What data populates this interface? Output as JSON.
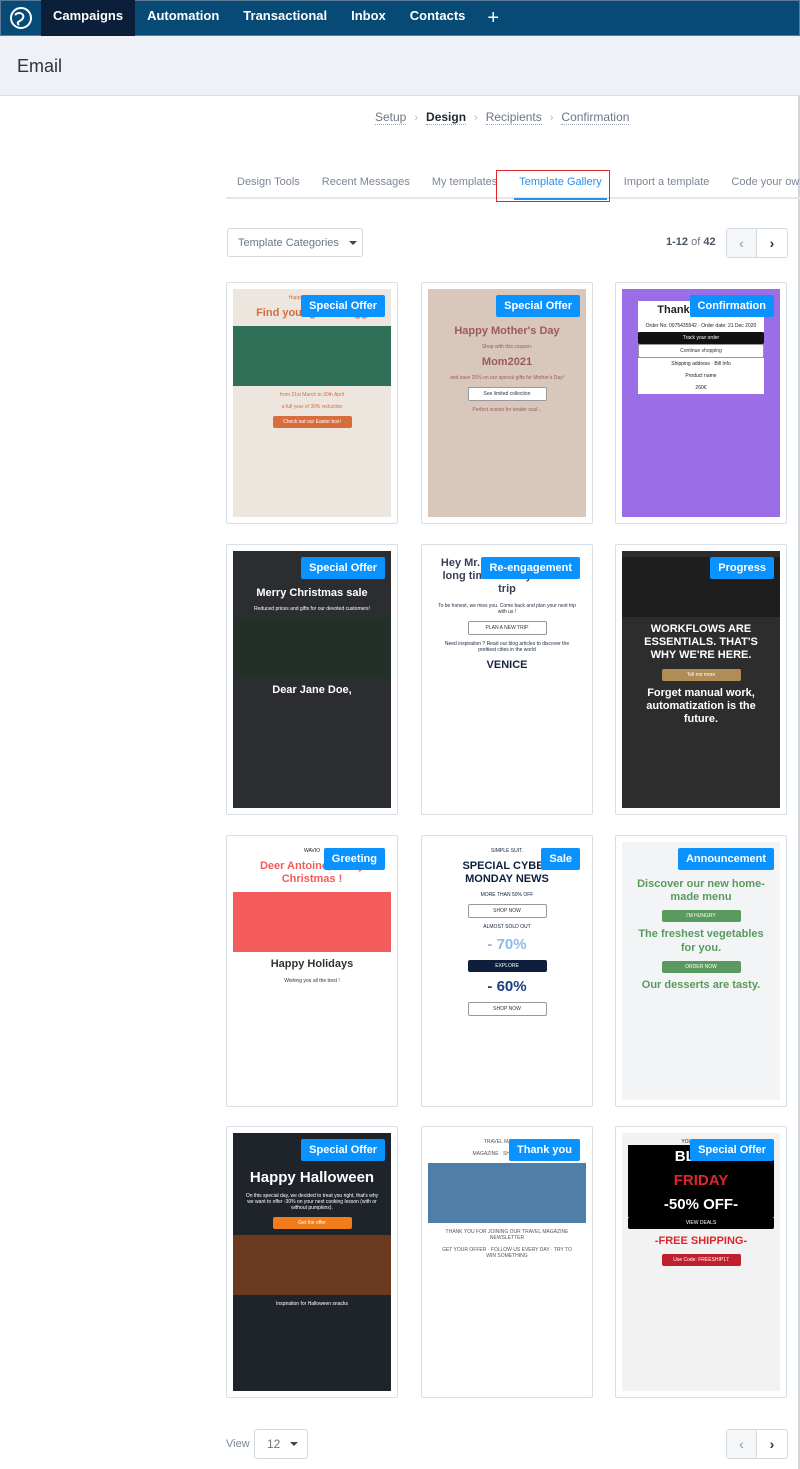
{
  "nav": {
    "items": [
      {
        "label": "Campaigns",
        "active": true
      },
      {
        "label": "Automation"
      },
      {
        "label": "Transactional"
      },
      {
        "label": "Inbox"
      },
      {
        "label": "Contacts"
      }
    ],
    "plus": "+"
  },
  "header": {
    "title": "Email"
  },
  "breadcrumb": [
    {
      "label": "Setup"
    },
    {
      "label": "Design",
      "current": true
    },
    {
      "label": "Recipients"
    },
    {
      "label": "Confirmation"
    }
  ],
  "tabs": [
    {
      "label": "Design Tools"
    },
    {
      "label": "Recent Messages"
    },
    {
      "label": "My templates"
    },
    {
      "label": "Template Gallery",
      "active": true
    },
    {
      "label": "Import a template"
    },
    {
      "label": "Code your own"
    }
  ],
  "toolbar": {
    "categories": "Template Categories",
    "range": "1-12",
    "of": "of",
    "total": "42",
    "prev": "‹",
    "next": "›"
  },
  "footer": {
    "view_label": "View",
    "view_value": "12"
  },
  "colors": {
    "nav": "#064a75",
    "accent": "#2a8ff0",
    "badge": "#0a92ff"
  },
  "templates": [
    {
      "badge": "Special Offer",
      "bg": "#ece6df",
      "fg": "#d76d3c",
      "lines": [
        {
          "t": "Happy Easter to you!",
          "s": "body"
        },
        {
          "t": "Find your golden egg",
          "s": "title"
        },
        {
          "t": "",
          "s": "img",
          "c": "#2f6e57"
        },
        {
          "t": "from 21st March to 30th April",
          "s": "body"
        },
        {
          "t": "a full year of 30% reduction",
          "s": "body"
        },
        {
          "t": "Check out our Easter box!",
          "s": "btn",
          "c": "#d76d3c"
        }
      ]
    },
    {
      "badge": "Special Offer",
      "bg": "#d9c7bb",
      "fg": "#9a5b60",
      "lines": [
        {
          "t": "",
          "s": "spacer"
        },
        {
          "t": "Happy Mother's Day",
          "s": "title"
        },
        {
          "t": "Shop with this coupon:",
          "s": "body"
        },
        {
          "t": "Mom2021",
          "s": "title"
        },
        {
          "t": "and save 25% on our special gifts for Mother's Day!",
          "s": "body"
        },
        {
          "t": "See limited collection",
          "s": "btn",
          "c": "#ffffff"
        },
        {
          "t": "Perfect scents for tender soul...",
          "s": "body"
        }
      ]
    },
    {
      "badge": "Confirmation",
      "bg": "#9b6ee8",
      "fg": "#222",
      "lines": [
        {
          "t": "ECHOES",
          "s": "body"
        },
        {
          "t": "Thank you John,",
          "s": "title"
        },
        {
          "t": "Order No: 0075435542 · Order date: 21 Dec 2020",
          "s": "body"
        },
        {
          "t": "Track your order",
          "s": "btn",
          "c": "#111"
        },
        {
          "t": "Continue shopping",
          "s": "btn",
          "c": "#fff"
        },
        {
          "t": "Shipping address · Bill Info",
          "s": "body"
        },
        {
          "t": "Product name",
          "s": "body"
        },
        {
          "t": "260€",
          "s": "body"
        }
      ]
    },
    {
      "badge": "Special Offer",
      "bg": "#2b2d30",
      "fg": "#ffffff",
      "lines": [
        {
          "t": "",
          "s": "spacer"
        },
        {
          "t": "Merry Christmas sale",
          "s": "title"
        },
        {
          "t": "Reduced prices and gifts for our devoted customers!",
          "s": "body"
        },
        {
          "t": "",
          "s": "img",
          "c": "#23302a"
        },
        {
          "t": "Dear Jane Doe,",
          "s": "title"
        }
      ]
    },
    {
      "badge": "Re-engagement",
      "bg": "#ffffff",
      "fg": "#2b2d40",
      "lines": [
        {
          "t": "Hey Mr. Smith, It's been a long time since your last trip",
          "s": "title",
          "c": "#3a3f5a"
        },
        {
          "t": "To be honest, we miss you. Come back and plan your next trip with us !",
          "s": "body"
        },
        {
          "t": "PLAN A NEW TRIP",
          "s": "btn",
          "c": "#fff"
        },
        {
          "t": "Need inspiration ? Read our blog articles to discover the prettiest cities in the world",
          "s": "body",
          "c": "#1b2540"
        },
        {
          "t": "VENICE",
          "s": "title",
          "c": "#1b2540"
        }
      ]
    },
    {
      "badge": "Progress",
      "bg": "#2d2d2d",
      "fg": "#ffffff",
      "lines": [
        {
          "t": "",
          "s": "img",
          "c": "#1e1e1e"
        },
        {
          "t": "WORKFLOWS ARE ESSENTIALS. THAT'S WHY WE'RE HERE.",
          "s": "title"
        },
        {
          "t": "Tell me more",
          "s": "btn",
          "c": "#b08d57"
        },
        {
          "t": "Forget manual work, automatization is the future.",
          "s": "title"
        }
      ]
    },
    {
      "badge": "Greeting",
      "bg": "#ffffff",
      "fg": "#333",
      "lines": [
        {
          "t": "WAVIO",
          "s": "body",
          "c": "#222"
        },
        {
          "t": "Deer Antoine, Merry Christmas !",
          "s": "title",
          "c": "#f45b5b"
        },
        {
          "t": "",
          "s": "img",
          "c": "#f45b5b"
        },
        {
          "t": "Happy Holidays",
          "s": "title"
        },
        {
          "t": "Wishing you all the best !",
          "s": "body"
        }
      ]
    },
    {
      "badge": "Sale",
      "bg": "#ffffff",
      "fg": "#0e1f3d",
      "lines": [
        {
          "t": "SIMPLE SUIT.",
          "s": "body",
          "c": "#0e1f3d"
        },
        {
          "t": "SPECIAL CYBER MONDAY NEWS",
          "s": "title",
          "c": "#0e1f3d"
        },
        {
          "t": "MORE THAN 50% OFF",
          "s": "body",
          "c": "#0e1f3d"
        },
        {
          "t": "SHOP NOW",
          "s": "btn",
          "c": "#fff"
        },
        {
          "t": "ALMOST SOLD OUT",
          "s": "body"
        },
        {
          "t": "- 70%",
          "s": "big",
          "c": "#8fb8e8"
        },
        {
          "t": "EXPLORE",
          "s": "btn",
          "c": "#0e1f3d"
        },
        {
          "t": "- 60%",
          "s": "big",
          "c": "#1d3f7e"
        },
        {
          "t": "SHOP NOW",
          "s": "btn",
          "c": "#fff"
        }
      ]
    },
    {
      "badge": "Announcement",
      "bg": "#f2f4f5",
      "fg": "#5b9a5f",
      "lines": [
        {
          "t": "",
          "s": "spacer"
        },
        {
          "t": "Discover our new home-made menu",
          "s": "title"
        },
        {
          "t": "I'M HUNGRY",
          "s": "btn",
          "c": "#5b9a5f"
        },
        {
          "t": "The freshest vegetables for you.",
          "s": "title"
        },
        {
          "t": "ORDER NOW",
          "s": "btn",
          "c": "#5b9a5f"
        },
        {
          "t": "Our desserts are tasty.",
          "s": "title",
          "c": "#5b9a5f"
        }
      ]
    },
    {
      "badge": "Special Offer",
      "bg": "#1f242b",
      "fg": "#ffffff",
      "lines": [
        {
          "t": "",
          "s": "spacer"
        },
        {
          "t": "Happy Halloween",
          "s": "big"
        },
        {
          "t": "On this special day, we decided to treat you right, that's why we want to offer -30% on your next cooking lesson (with or without pumpkins).",
          "s": "body"
        },
        {
          "t": "Get the offer",
          "s": "btn",
          "c": "#f07d1a"
        },
        {
          "t": "",
          "s": "img",
          "c": "#6b3a20"
        },
        {
          "t": "Inspiration for Halloween snacks",
          "s": "body",
          "c": "#fff"
        }
      ]
    },
    {
      "badge": "Thank you",
      "bg": "#ffffff",
      "fg": "#555",
      "lines": [
        {
          "t": "TRAVEL MAGAZINE",
          "s": "body"
        },
        {
          "t": "MAGAZINE · SHOP · EVENTS",
          "s": "body"
        },
        {
          "t": "",
          "s": "img",
          "c": "#4f7fa8"
        },
        {
          "t": "THANK YOU FOR JOINING OUR TRAVEL MAGAZINE NEWSLETTER",
          "s": "body"
        },
        {
          "t": "GET YOUR OFFER · FOLLOW US EVERY DAY · TRY TO WIN SOMETHING",
          "s": "body"
        }
      ]
    },
    {
      "badge": "Special Offer",
      "bg": "#f2f2f2",
      "fg": "#ffffff",
      "lines": [
        {
          "t": "YOURCOMPANY",
          "s": "body",
          "c": "#222"
        },
        {
          "t": "BLACK",
          "s": "big",
          "c": "#111"
        },
        {
          "t": "FRIDAY",
          "s": "big",
          "c": "#111"
        },
        {
          "t": "-50% OFF-",
          "s": "big",
          "c": "#111"
        },
        {
          "t": "VIEW DEALS",
          "s": "btn",
          "c": "#e0262b"
        },
        {
          "t": "-FREE SHIPPING-",
          "s": "title",
          "c": "#f2f2f2"
        },
        {
          "t": "Use Code: FREESHIP17",
          "s": "btn",
          "c": "#c01f2f"
        }
      ]
    }
  ]
}
